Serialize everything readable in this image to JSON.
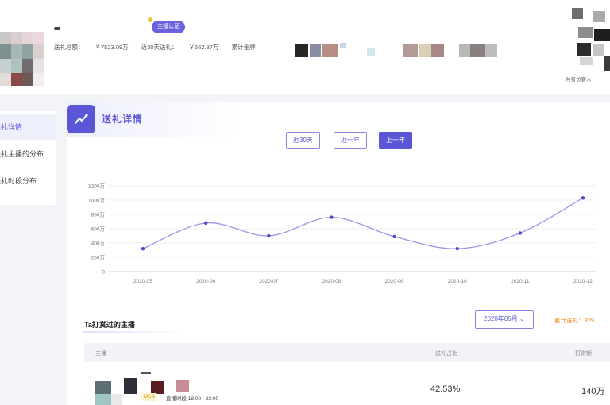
{
  "header": {
    "badge": "主播认证",
    "stats": [
      {
        "label": "送礼总额：",
        "value": "￥7523.09万"
      },
      {
        "label": "近30天送礼：",
        "value": "￥662.37万"
      },
      {
        "label": "累计金牌：",
        "value": ""
      }
    ],
    "right_text": "共有访客人"
  },
  "sidebar": {
    "items": [
      {
        "label": "送礼详情"
      },
      {
        "label": "送礼主播的分布"
      },
      {
        "label": "送礼时段分布"
      }
    ]
  },
  "panel": {
    "title": "送礼详情",
    "segments": [
      "近30天",
      "近一年",
      "上一年"
    ],
    "active_segment": "上一年"
  },
  "chart_data": {
    "type": "line",
    "x": [
      "2020-05",
      "2020-06",
      "2020-07",
      "2020-08",
      "2020-09",
      "2020-10",
      "2020-11",
      "2020-12"
    ],
    "values": [
      320,
      680,
      500,
      760,
      490,
      320,
      540,
      1030
    ],
    "y_ticks": [
      "0",
      "200万",
      "400万",
      "600万",
      "800万",
      "1000万",
      "1200万"
    ],
    "ylim": [
      0,
      1200
    ],
    "grid": true,
    "line_color": "#9a97e8",
    "point_color": "#4d49c9"
  },
  "section": {
    "title": "Ta打赏过的主播",
    "month_select": "2020年05月",
    "month_icon": "chevron-down-icon",
    "note": "累计送礼：329"
  },
  "table": {
    "headers": [
      "主播",
      "送礼占比",
      "打赏额"
    ],
    "rows": [
      {
        "tag": "MCN",
        "time": "直播时段 18:00 - 23:00",
        "ratio": "42.53%",
        "total": "140万"
      }
    ]
  },
  "colors": {
    "accent": "#5b56d6",
    "orange": "#f08a1c"
  }
}
